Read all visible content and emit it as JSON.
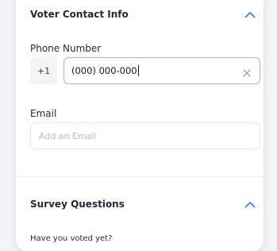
{
  "voter_contact": {
    "title": "Voter Contact Info",
    "toggle_icon": "chevron-up-icon",
    "phone": {
      "label": "Phone Number",
      "country_code": "+1",
      "value": "(000) 000-000",
      "clear_icon": "close-icon"
    },
    "email": {
      "label": "Email",
      "placeholder": "Add an Email",
      "value": ""
    }
  },
  "survey": {
    "title": "Survey Questions",
    "toggle_icon": "chevron-up-icon",
    "first_question": "Have you voted yet?"
  },
  "colors": {
    "accent": "#3b82f6",
    "focus_border": "#9fb8e6",
    "card_background": "#ffffff",
    "page_background": "#f3f4f6"
  }
}
